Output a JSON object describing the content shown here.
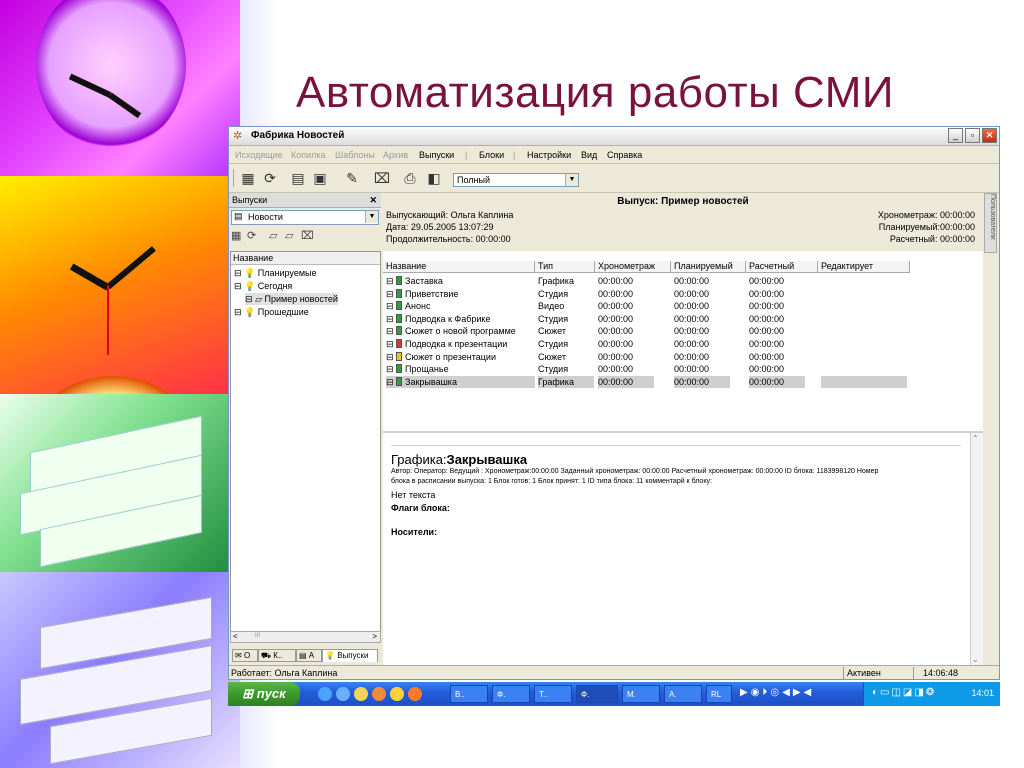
{
  "slide": {
    "title": "Автоматизация работы СМИ"
  },
  "window": {
    "title": "Фабрика Новостей",
    "controls": {
      "minimize": "_",
      "restore": "▫",
      "close": "✕"
    }
  },
  "menu": {
    "disabled_items": [
      "Исходящие",
      "Копилка",
      "Шаблоны",
      "Архив"
    ],
    "items": [
      "Выпуски",
      "Блоки",
      "Настройки",
      "Вид",
      "Справка"
    ],
    "separator": "|"
  },
  "toolbar": {
    "view_combo_value": "Полный"
  },
  "left_panel": {
    "header": "Выпуски",
    "close": "✕",
    "category_combo_value": "Новости",
    "tree_column": "Название",
    "tree": [
      {
        "label": "Планируемые",
        "icon": "bulb-icon"
      },
      {
        "label": "Сегодня",
        "icon": "bulb-icon"
      },
      {
        "label": "Пример новостей",
        "icon": "folder-icon"
      },
      {
        "label": "Прошедшие",
        "icon": "bulb-icon"
      }
    ],
    "scroll_left": "<",
    "scroll_mid": "III",
    "scroll_right": ">",
    "tabs": [
      "О",
      "К..",
      "А",
      "Выпуски"
    ]
  },
  "side_tab": "Пользователи",
  "issue": {
    "title": "Выпуск: Пример новостей",
    "producer": "Выпускающий: Ольга Каплина",
    "date": "Дата: 29.05.2005 13:07:29",
    "duration": "Продолжительность: 00:00:00",
    "timing_chrono": "Хронометраж: 00:00:00",
    "timing_planned": "Планируемый:00:00:00",
    "timing_calc": "Расчетный: 00:00:00"
  },
  "grid": {
    "columns": [
      "Название",
      "Тип",
      "Хронометраж",
      "Планируемый",
      "Расчетный",
      "Редактирует"
    ],
    "rows": [
      {
        "name": "Заставка",
        "type": "Графика",
        "chrono": "00:00:00",
        "planned": "00:00:00",
        "calc": "00:00:00",
        "editor": "",
        "color": "#2e9e3a"
      },
      {
        "name": "Приветствие",
        "type": "Студия",
        "chrono": "00:00:00",
        "planned": "00:00:00",
        "calc": "00:00:00",
        "editor": "",
        "color": "#2e9e3a"
      },
      {
        "name": "Анонс",
        "type": "Видео",
        "chrono": "00:00:00",
        "planned": "00:00:00",
        "calc": "00:00:00",
        "editor": "",
        "color": "#2e9e3a"
      },
      {
        "name": "Подводка к Фабрике",
        "type": "Студия",
        "chrono": "00:00:00",
        "planned": "00:00:00",
        "calc": "00:00:00",
        "editor": "",
        "color": "#2e9e3a"
      },
      {
        "name": "Сюжет о новой программе",
        "type": "Сюжет",
        "chrono": "00:00:00",
        "planned": "00:00:00",
        "calc": "00:00:00",
        "editor": "",
        "color": "#2e9e3a"
      },
      {
        "name": "Подводка к презентации",
        "type": "Студия",
        "chrono": "00:00:00",
        "planned": "00:00:00",
        "calc": "00:00:00",
        "editor": "",
        "color": "#d93a2b"
      },
      {
        "name": "Сюжет о презентации",
        "type": "Сюжет",
        "chrono": "00:00:00",
        "planned": "00:00:00",
        "calc": "00:00:00",
        "editor": "",
        "color": "#f0c419"
      },
      {
        "name": "Прощанье",
        "type": "Студия",
        "chrono": "00:00:00",
        "planned": "00:00:00",
        "calc": "00:00:00",
        "editor": "",
        "color": "#2e9e3a"
      },
      {
        "name": "Закрывашка",
        "type": "Графика",
        "chrono": "00:00:00",
        "planned": "00:00:00",
        "calc": "00:00:00",
        "editor": "",
        "color": "#2e9e3a",
        "selected": true
      }
    ]
  },
  "detail": {
    "type_prefix": "Графика:",
    "block_name": "Закрывашка",
    "meta_line1": "Автор: Оператор: Ведущий : Хронометраж:00:00:00 Заданный хронометраж: 00:00:00 Расчетный хронометраж: 00:00:00 ID блока: 1183998120 Номер",
    "meta_line2": "блока в расписании выпуска: 1 Блок готов: 1 Блок принят: 1 ID типа блока: 11 комментарй к блоку:",
    "no_text": "Нет текста",
    "flags": "Флаги блока:",
    "media": "Носители:"
  },
  "status": {
    "user": "Работает: Ольга Каплина",
    "state": "Активен",
    "time": "14:06:48"
  },
  "taskbar": {
    "start": "пуск",
    "tasks": [
      "В..",
      "Ф.",
      "Т..",
      "Ф.",
      "М.",
      "А.",
      "RL"
    ],
    "clock": "14:01"
  }
}
